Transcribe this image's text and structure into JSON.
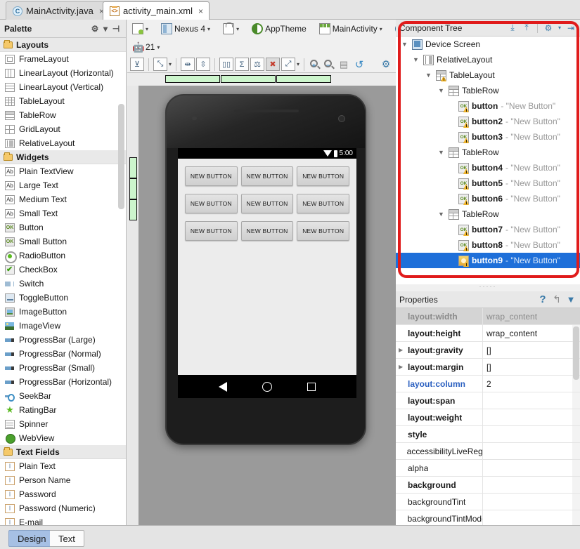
{
  "tabs": [
    {
      "label": "MainActivity.java",
      "icon": "java-class-icon",
      "glyph": "C",
      "active": false,
      "close": "×"
    },
    {
      "label": "activity_main.xml",
      "icon": "xml-file-icon",
      "glyph": "<>",
      "active": true,
      "close": "×"
    }
  ],
  "palette": {
    "title": "Palette",
    "gear": "⚙",
    "gear_caret": "▾",
    "collapse": "⊣",
    "groups": [
      {
        "label": "Layouts",
        "icon": "folder-icon",
        "items": [
          {
            "label": "FrameLayout",
            "icon": "frame-layout-icon"
          },
          {
            "label": "LinearLayout (Horizontal)",
            "icon": "linear-layout-horizontal-icon"
          },
          {
            "label": "LinearLayout (Vertical)",
            "icon": "linear-layout-vertical-icon"
          },
          {
            "label": "TableLayout",
            "icon": "table-layout-icon"
          },
          {
            "label": "TableRow",
            "icon": "table-row-icon"
          },
          {
            "label": "GridLayout",
            "icon": "grid-layout-icon"
          },
          {
            "label": "RelativeLayout",
            "icon": "relative-layout-icon"
          }
        ]
      },
      {
        "label": "Widgets",
        "icon": "folder-icon",
        "items": [
          {
            "label": "Plain TextView",
            "icon": "text-view-icon",
            "glyph": "Ab"
          },
          {
            "label": "Large Text",
            "icon": "text-view-icon",
            "glyph": "Ab"
          },
          {
            "label": "Medium Text",
            "icon": "text-view-icon",
            "glyph": "Ab"
          },
          {
            "label": "Small Text",
            "icon": "text-view-icon",
            "glyph": "Ab"
          },
          {
            "label": "Button",
            "icon": "button-icon",
            "glyph": "OK"
          },
          {
            "label": "Small Button",
            "icon": "button-icon",
            "glyph": "OK"
          },
          {
            "label": "RadioButton",
            "icon": "radio-button-icon"
          },
          {
            "label": "CheckBox",
            "icon": "checkbox-icon"
          },
          {
            "label": "Switch",
            "icon": "switch-icon"
          },
          {
            "label": "ToggleButton",
            "icon": "toggle-button-icon"
          },
          {
            "label": "ImageButton",
            "icon": "image-button-icon"
          },
          {
            "label": "ImageView",
            "icon": "image-view-icon"
          },
          {
            "label": "ProgressBar (Large)",
            "icon": "progress-bar-icon"
          },
          {
            "label": "ProgressBar (Normal)",
            "icon": "progress-bar-icon"
          },
          {
            "label": "ProgressBar (Small)",
            "icon": "progress-bar-icon"
          },
          {
            "label": "ProgressBar (Horizontal)",
            "icon": "progress-bar-icon"
          },
          {
            "label": "SeekBar",
            "icon": "seek-bar-icon"
          },
          {
            "label": "RatingBar",
            "icon": "rating-bar-icon",
            "glyph": "★"
          },
          {
            "label": "Spinner",
            "icon": "spinner-icon"
          },
          {
            "label": "WebView",
            "icon": "web-view-icon"
          }
        ]
      },
      {
        "label": "Text Fields",
        "icon": "folder-icon",
        "items": [
          {
            "label": "Plain Text",
            "icon": "text-field-icon",
            "glyph": "I"
          },
          {
            "label": "Person Name",
            "icon": "text-field-icon",
            "glyph": "I"
          },
          {
            "label": "Password",
            "icon": "text-field-icon",
            "glyph": "I"
          },
          {
            "label": "Password (Numeric)",
            "icon": "text-field-icon",
            "glyph": "I"
          },
          {
            "label": "E-mail",
            "icon": "text-field-icon",
            "glyph": "I"
          }
        ]
      }
    ]
  },
  "design_toolbar": {
    "row1": [
      {
        "name": "layout-variant-button",
        "label": "",
        "icon": "layout-file-icon",
        "caret": "▾"
      },
      {
        "name": "device-button",
        "label": "Nexus 4",
        "icon": "device-icon",
        "caret": "▾"
      },
      {
        "name": "orientation-button",
        "label": "",
        "icon": "orientation-icon",
        "caret": "▾"
      },
      {
        "name": "theme-button",
        "label": "AppTheme",
        "icon": "theme-icon",
        "caret": ""
      },
      {
        "name": "activity-button",
        "label": "MainActivity",
        "icon": "activity-icon",
        "caret": "▾"
      },
      {
        "name": "locale-button",
        "label": "",
        "icon": "locale-icon",
        "caret": "▾"
      }
    ],
    "row2": [
      {
        "name": "api-level-button",
        "label": "21",
        "icon": "android-icon",
        "caret": "▾"
      }
    ],
    "row3": [
      {
        "name": "toggle-render-button",
        "icon": "render-toggle-icon",
        "glyph": "⊻"
      },
      {
        "name": "zoom-fit-button",
        "icon": "zoom-fit-icon",
        "glyph": "⤡",
        "caret": "▾"
      },
      {
        "name": "distribute-horizontally-button",
        "icon": "distribute-h-icon",
        "glyph": "⇹"
      },
      {
        "name": "distribute-vertically-button",
        "icon": "distribute-v-icon",
        "glyph": "⇳"
      },
      {
        "name": "layout-columns-button",
        "icon": "columns-icon",
        "glyph": "▯▯"
      },
      {
        "name": "sum-button",
        "icon": "sigma-icon",
        "glyph": "Σ"
      },
      {
        "name": "balance-button",
        "icon": "balance-icon",
        "glyph": "⚖"
      },
      {
        "name": "delete-all-constraints-button",
        "icon": "clear-constraints-icon",
        "glyph": "✖"
      },
      {
        "name": "expand-button",
        "icon": "expand-icon",
        "glyph": "⤢",
        "caret": "▾"
      },
      {
        "name": "zoom-in-button",
        "icon": "zoom-in-icon",
        "glyph": "+"
      },
      {
        "name": "zoom-out-button",
        "icon": "zoom-out-icon",
        "glyph": "−"
      },
      {
        "name": "zoom-actual-button",
        "icon": "document-icon",
        "glyph": "▤"
      },
      {
        "name": "refresh-button",
        "icon": "refresh-icon",
        "glyph": "↺"
      },
      {
        "name": "settings-button",
        "icon": "gear-icon",
        "glyph": "⚙"
      }
    ]
  },
  "preview": {
    "status_clock": "5:00",
    "status_wifi_icon": "wifi-icon",
    "status_battery_icon": "battery-icon",
    "nav_back_icon": "back-triangle-icon",
    "nav_home_icon": "home-circle-icon",
    "nav_recents_icon": "recents-square-icon",
    "button_label": "NEW BUTTON",
    "rows": [
      [
        "NEW BUTTON",
        "NEW BUTTON",
        "NEW BUTTON"
      ],
      [
        "NEW BUTTON",
        "NEW BUTTON",
        "NEW BUTTON"
      ],
      [
        "NEW BUTTON",
        "NEW BUTTON",
        "NEW BUTTON"
      ]
    ],
    "selected_row": 2,
    "selected_col": 2
  },
  "component_tree": {
    "title": "Component Tree",
    "expand_all_icon": "expand-all-icon",
    "collapse_all_icon": "collapse-all-icon",
    "gear_icon": "gear-icon",
    "gear_caret": "▾",
    "hide_icon": "hide-panel-icon",
    "nodes": [
      {
        "indent": 0,
        "twisty": "▼",
        "icon": "device-screen-icon",
        "name": "Device Screen",
        "desc": "",
        "warn": false,
        "selected": false
      },
      {
        "indent": 1,
        "twisty": "▼",
        "icon": "relative-layout-icon",
        "name": "RelativeLayout",
        "desc": "",
        "warn": false,
        "selected": false
      },
      {
        "indent": 2,
        "twisty": "▼",
        "icon": "table-layout-icon",
        "name": "TableLayout",
        "desc": "",
        "warn": true,
        "selected": false
      },
      {
        "indent": 3,
        "twisty": "▼",
        "icon": "table-row-icon",
        "name": "TableRow",
        "desc": "",
        "warn": false,
        "selected": false
      },
      {
        "indent": 4,
        "twisty": "",
        "icon": "button-icon",
        "name": "button",
        "desc": "- \"New Button\"",
        "warn": true,
        "selected": false
      },
      {
        "indent": 4,
        "twisty": "",
        "icon": "button-icon",
        "name": "button2",
        "desc": "- \"New Button\"",
        "warn": true,
        "selected": false
      },
      {
        "indent": 4,
        "twisty": "",
        "icon": "button-icon",
        "name": "button3",
        "desc": "- \"New Button\"",
        "warn": true,
        "selected": false
      },
      {
        "indent": 3,
        "twisty": "▼",
        "icon": "table-row-icon",
        "name": "TableRow",
        "desc": "",
        "warn": false,
        "selected": false
      },
      {
        "indent": 4,
        "twisty": "",
        "icon": "button-icon",
        "name": "button4",
        "desc": "- \"New Button\"",
        "warn": true,
        "selected": false
      },
      {
        "indent": 4,
        "twisty": "",
        "icon": "button-icon",
        "name": "button5",
        "desc": "- \"New Button\"",
        "warn": true,
        "selected": false
      },
      {
        "indent": 4,
        "twisty": "",
        "icon": "button-icon",
        "name": "button6",
        "desc": "- \"New Button\"",
        "warn": true,
        "selected": false
      },
      {
        "indent": 3,
        "twisty": "▼",
        "icon": "table-row-icon",
        "name": "TableRow",
        "desc": "",
        "warn": false,
        "selected": false
      },
      {
        "indent": 4,
        "twisty": "",
        "icon": "button-icon",
        "name": "button7",
        "desc": "- \"New Button\"",
        "warn": true,
        "selected": false
      },
      {
        "indent": 4,
        "twisty": "",
        "icon": "button-icon",
        "name": "button8",
        "desc": "- \"New Button\"",
        "warn": true,
        "selected": false
      },
      {
        "indent": 4,
        "twisty": "",
        "icon": "button-icon-selected",
        "name": "button9",
        "desc": "- \"New Button\"",
        "warn": true,
        "selected": true
      }
    ]
  },
  "properties": {
    "title": "Properties",
    "help_icon": "help-question-icon",
    "revert_icon": "undo-arrow-icon",
    "filter_icon": "filter-funnel-icon",
    "rows": [
      {
        "name": "layout:width",
        "value": "wrap_content",
        "expandable": false,
        "style": "selected"
      },
      {
        "name": "layout:height",
        "value": "wrap_content",
        "expandable": false,
        "style": "bold"
      },
      {
        "name": "layout:gravity",
        "value": "[]",
        "expandable": true,
        "style": "bold"
      },
      {
        "name": "layout:margin",
        "value": "[]",
        "expandable": true,
        "style": "bold"
      },
      {
        "name": "layout:column",
        "value": "2",
        "expandable": false,
        "style": "blue"
      },
      {
        "name": "layout:span",
        "value": "",
        "expandable": false,
        "style": "bold"
      },
      {
        "name": "layout:weight",
        "value": "",
        "expandable": false,
        "style": "bold"
      },
      {
        "name": "style",
        "value": "",
        "expandable": false,
        "style": "bold"
      },
      {
        "name": "accessibilityLiveRegion",
        "value": "",
        "expandable": false,
        "style": "normal"
      },
      {
        "name": "alpha",
        "value": "",
        "expandable": false,
        "style": "normal"
      },
      {
        "name": "background",
        "value": "",
        "expandable": false,
        "style": "bold"
      },
      {
        "name": "backgroundTint",
        "value": "",
        "expandable": false,
        "style": "normal"
      },
      {
        "name": "backgroundTintMode",
        "value": "",
        "expandable": false,
        "style": "normal"
      }
    ]
  },
  "bottom_tabs": [
    {
      "label": "Design",
      "active": true
    },
    {
      "label": "Text",
      "active": false
    }
  ],
  "colors": {
    "selection_blue": "#1e6fd9",
    "annotation_red": "#e01b1b",
    "marker_green": "#ccf5cc",
    "handle_cyan": "#19d5f5",
    "accent_blue": "#3a7aa8"
  }
}
